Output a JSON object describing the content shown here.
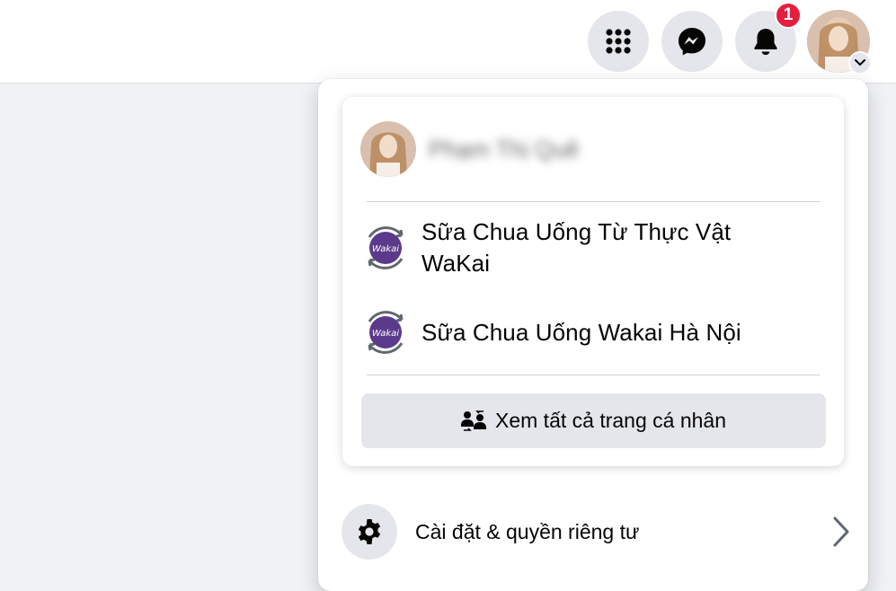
{
  "topbar": {
    "notification_count": "1",
    "icons": [
      "menu-grid-icon",
      "messenger-icon",
      "bell-icon",
      "chevron-down-icon"
    ]
  },
  "account_menu": {
    "current_user": {
      "name": "Phạm Thị Quê"
    },
    "pages": [
      {
        "name_line1": "Sữa Chua Uống Từ Thực Vật",
        "name_line2": "WaKai",
        "logo_text": "Wakai"
      },
      {
        "name_line1": "Sữa Chua Uống Wakai Hà Nội",
        "logo_text": "Wakai"
      }
    ],
    "see_all_label": "Xem tất cả trang cá nhân",
    "settings_label": "Cài đặt & quyền riêng tư"
  },
  "colors": {
    "badge": "#e41e3f",
    "button_bg": "#e4e6eb",
    "page_bg": "#f0f2f5",
    "wakai_purple": "#5b3a8c"
  }
}
